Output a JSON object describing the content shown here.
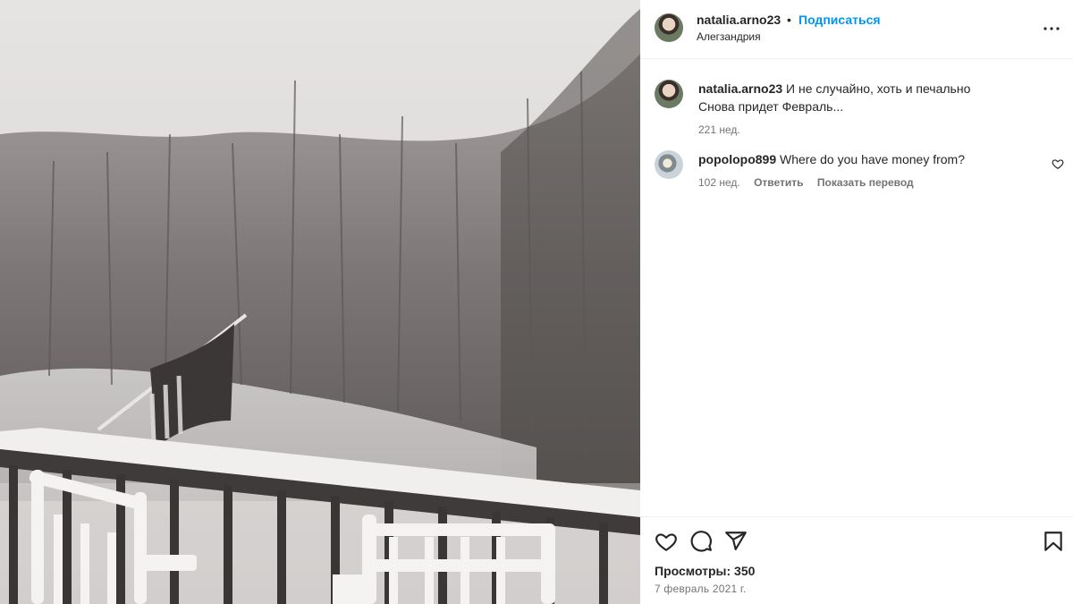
{
  "post": {
    "author": "natalia.arno23",
    "separator": "•",
    "follow_label": "Подписаться",
    "location": "Алегзандрия",
    "more_icon": "more-options-icon"
  },
  "comments": [
    {
      "username": "natalia.arno23",
      "text": "И не случайно, хоть и печально\nСнова придет Февраль...",
      "age": "221 нед."
    },
    {
      "username": "popolopo899",
      "text": "Where do you have money from?",
      "age": "102 нед.",
      "reply_label": "Ответить",
      "translate_label": "Показать перевод"
    }
  ],
  "actions": {
    "like_icon": "heart-icon",
    "comment_icon": "comment-icon",
    "share_icon": "share-icon",
    "save_icon": "bookmark-icon"
  },
  "stats": {
    "views": "Просмотры: 350",
    "date": "7 февраль 2021 г."
  }
}
